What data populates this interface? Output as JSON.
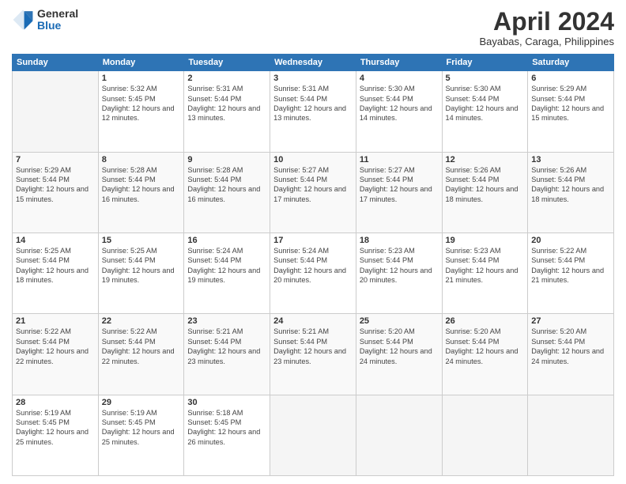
{
  "logo": {
    "general": "General",
    "blue": "Blue"
  },
  "header": {
    "month": "April 2024",
    "location": "Bayabas, Caraga, Philippines"
  },
  "weekdays": [
    "Sunday",
    "Monday",
    "Tuesday",
    "Wednesday",
    "Thursday",
    "Friday",
    "Saturday"
  ],
  "weeks": [
    [
      {
        "day": "",
        "empty": true
      },
      {
        "day": "1",
        "sunrise": "5:32 AM",
        "sunset": "5:45 PM",
        "daylight": "12 hours and 12 minutes."
      },
      {
        "day": "2",
        "sunrise": "5:31 AM",
        "sunset": "5:44 PM",
        "daylight": "12 hours and 13 minutes."
      },
      {
        "day": "3",
        "sunrise": "5:31 AM",
        "sunset": "5:44 PM",
        "daylight": "12 hours and 13 minutes."
      },
      {
        "day": "4",
        "sunrise": "5:30 AM",
        "sunset": "5:44 PM",
        "daylight": "12 hours and 14 minutes."
      },
      {
        "day": "5",
        "sunrise": "5:30 AM",
        "sunset": "5:44 PM",
        "daylight": "12 hours and 14 minutes."
      },
      {
        "day": "6",
        "sunrise": "5:29 AM",
        "sunset": "5:44 PM",
        "daylight": "12 hours and 15 minutes."
      }
    ],
    [
      {
        "day": "7",
        "sunrise": "5:29 AM",
        "sunset": "5:44 PM",
        "daylight": "12 hours and 15 minutes."
      },
      {
        "day": "8",
        "sunrise": "5:28 AM",
        "sunset": "5:44 PM",
        "daylight": "12 hours and 16 minutes."
      },
      {
        "day": "9",
        "sunrise": "5:28 AM",
        "sunset": "5:44 PM",
        "daylight": "12 hours and 16 minutes."
      },
      {
        "day": "10",
        "sunrise": "5:27 AM",
        "sunset": "5:44 PM",
        "daylight": "12 hours and 17 minutes."
      },
      {
        "day": "11",
        "sunrise": "5:27 AM",
        "sunset": "5:44 PM",
        "daylight": "12 hours and 17 minutes."
      },
      {
        "day": "12",
        "sunrise": "5:26 AM",
        "sunset": "5:44 PM",
        "daylight": "12 hours and 18 minutes."
      },
      {
        "day": "13",
        "sunrise": "5:26 AM",
        "sunset": "5:44 PM",
        "daylight": "12 hours and 18 minutes."
      }
    ],
    [
      {
        "day": "14",
        "sunrise": "5:25 AM",
        "sunset": "5:44 PM",
        "daylight": "12 hours and 18 minutes."
      },
      {
        "day": "15",
        "sunrise": "5:25 AM",
        "sunset": "5:44 PM",
        "daylight": "12 hours and 19 minutes."
      },
      {
        "day": "16",
        "sunrise": "5:24 AM",
        "sunset": "5:44 PM",
        "daylight": "12 hours and 19 minutes."
      },
      {
        "day": "17",
        "sunrise": "5:24 AM",
        "sunset": "5:44 PM",
        "daylight": "12 hours and 20 minutes."
      },
      {
        "day": "18",
        "sunrise": "5:23 AM",
        "sunset": "5:44 PM",
        "daylight": "12 hours and 20 minutes."
      },
      {
        "day": "19",
        "sunrise": "5:23 AM",
        "sunset": "5:44 PM",
        "daylight": "12 hours and 21 minutes."
      },
      {
        "day": "20",
        "sunrise": "5:22 AM",
        "sunset": "5:44 PM",
        "daylight": "12 hours and 21 minutes."
      }
    ],
    [
      {
        "day": "21",
        "sunrise": "5:22 AM",
        "sunset": "5:44 PM",
        "daylight": "12 hours and 22 minutes."
      },
      {
        "day": "22",
        "sunrise": "5:22 AM",
        "sunset": "5:44 PM",
        "daylight": "12 hours and 22 minutes."
      },
      {
        "day": "23",
        "sunrise": "5:21 AM",
        "sunset": "5:44 PM",
        "daylight": "12 hours and 23 minutes."
      },
      {
        "day": "24",
        "sunrise": "5:21 AM",
        "sunset": "5:44 PM",
        "daylight": "12 hours and 23 minutes."
      },
      {
        "day": "25",
        "sunrise": "5:20 AM",
        "sunset": "5:44 PM",
        "daylight": "12 hours and 24 minutes."
      },
      {
        "day": "26",
        "sunrise": "5:20 AM",
        "sunset": "5:44 PM",
        "daylight": "12 hours and 24 minutes."
      },
      {
        "day": "27",
        "sunrise": "5:20 AM",
        "sunset": "5:44 PM",
        "daylight": "12 hours and 24 minutes."
      }
    ],
    [
      {
        "day": "28",
        "sunrise": "5:19 AM",
        "sunset": "5:45 PM",
        "daylight": "12 hours and 25 minutes."
      },
      {
        "day": "29",
        "sunrise": "5:19 AM",
        "sunset": "5:45 PM",
        "daylight": "12 hours and 25 minutes."
      },
      {
        "day": "30",
        "sunrise": "5:18 AM",
        "sunset": "5:45 PM",
        "daylight": "12 hours and 26 minutes."
      },
      {
        "day": "",
        "empty": true
      },
      {
        "day": "",
        "empty": true
      },
      {
        "day": "",
        "empty": true
      },
      {
        "day": "",
        "empty": true
      }
    ]
  ]
}
